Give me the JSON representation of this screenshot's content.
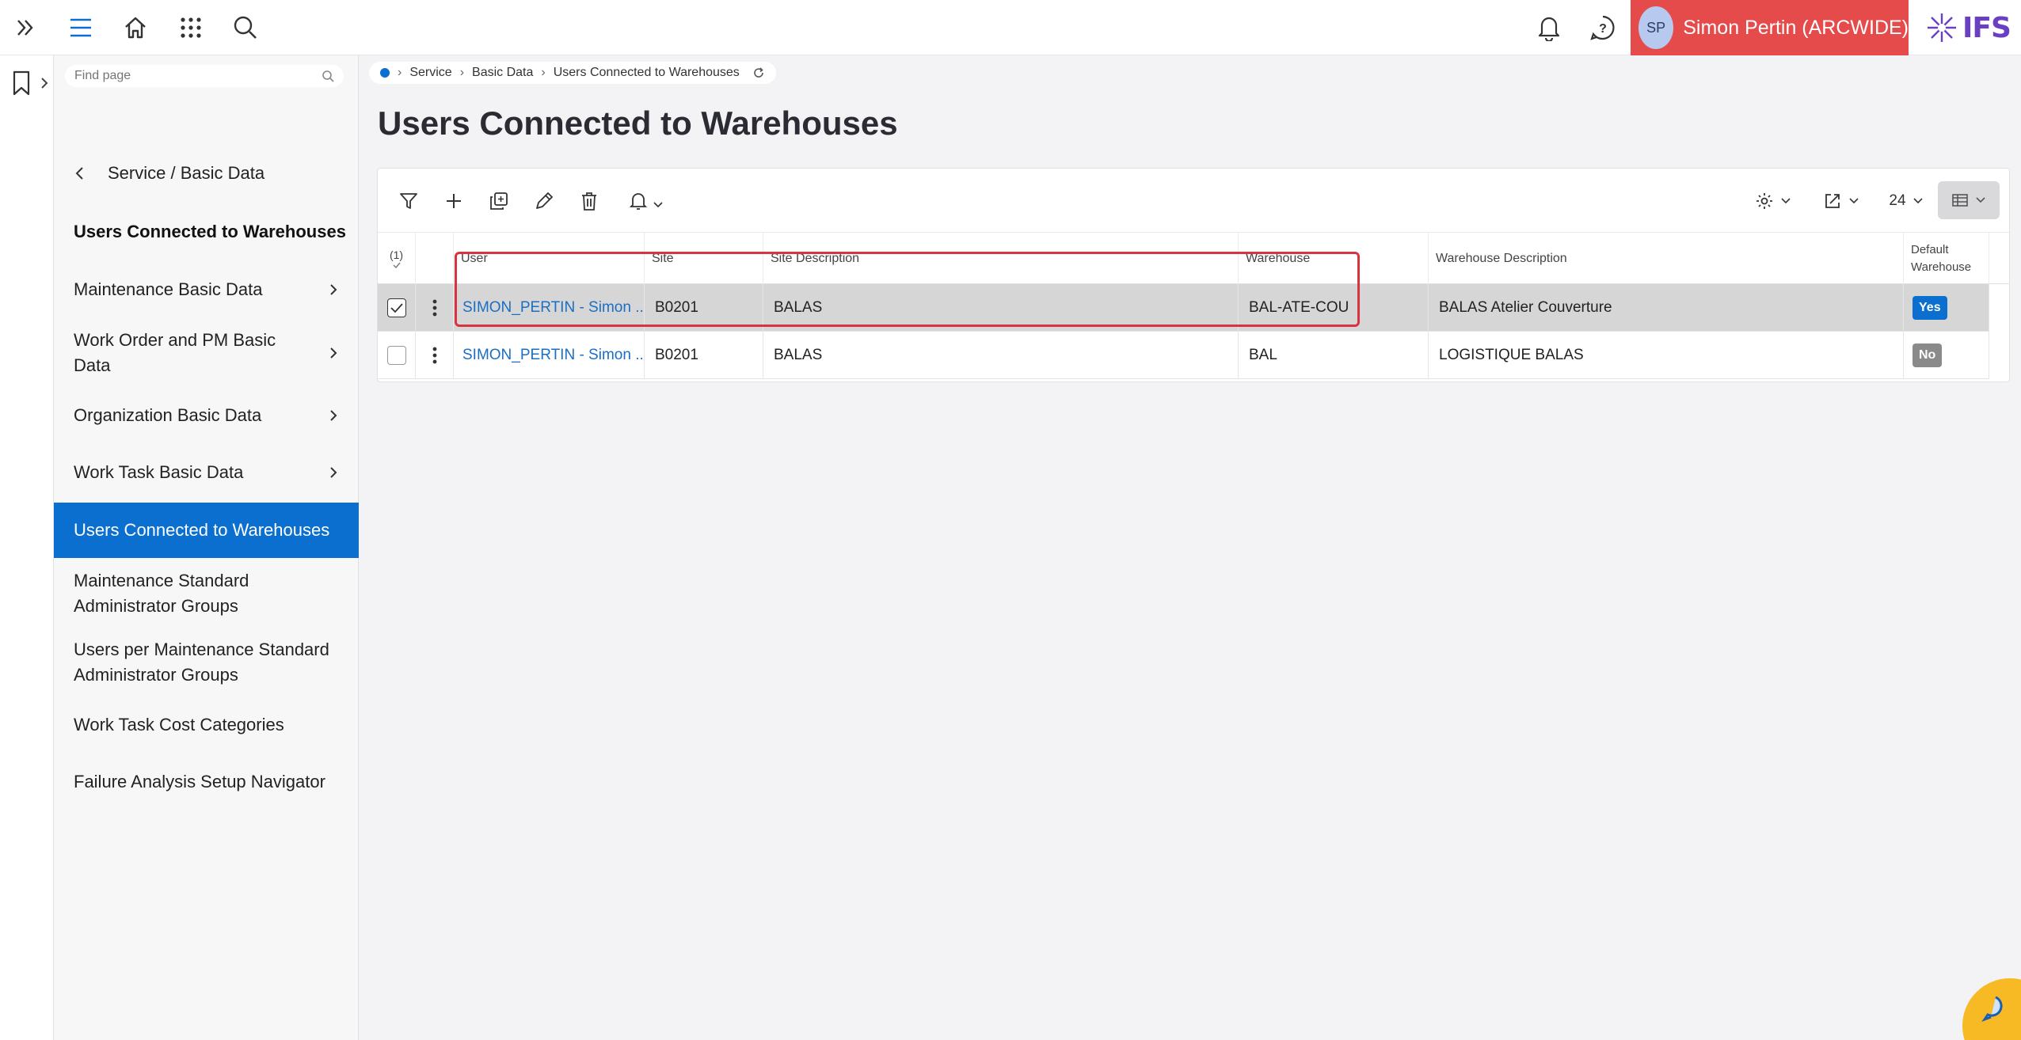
{
  "topbar": {
    "user": {
      "initials": "SP",
      "name": "Simon Pertin (ARCWIDE)"
    },
    "logo_text": "IFS",
    "colors": {
      "user_block": "#e64b4b",
      "avatar": "#b7c9ee",
      "logo": "#6b3fc2"
    },
    "icons": [
      "expand-icon",
      "menu-icon",
      "home-icon",
      "apps-grid-icon",
      "search-icon",
      "bell-icon",
      "help-icon"
    ]
  },
  "nav": {
    "find_placeholder": "Find page",
    "back_label": "Service / Basic Data",
    "title": "Users Connected to Warehouses",
    "items": [
      {
        "label": "Maintenance Basic Data",
        "has_children": true
      },
      {
        "label": "Work Order and PM Basic Data",
        "has_children": true
      },
      {
        "label": "Organization Basic Data",
        "has_children": true
      },
      {
        "label": "Work Task Basic Data",
        "has_children": true
      },
      {
        "label": "Users Connected to Warehouses",
        "active": true
      },
      {
        "label": "Maintenance Standard Administrator Groups"
      },
      {
        "label": "Users per Maintenance Standard Administrator Groups"
      },
      {
        "label": "Work Task Cost Categories"
      },
      {
        "label": "Failure Analysis Setup Navigator"
      }
    ]
  },
  "breadcrumb": [
    "Service",
    "Basic Data",
    "Users Connected to Warehouses"
  ],
  "page_title": "Users Connected to Warehouses",
  "toolbar": {
    "page_size": "24"
  },
  "table": {
    "selected_count": "(1)",
    "columns": {
      "user": "User",
      "site": "Site",
      "site_description": "Site Description",
      "warehouse": "Warehouse",
      "warehouse_description": "Warehouse Description",
      "default_warehouse_line1": "Default",
      "default_warehouse_line2": "Warehouse"
    },
    "rows": [
      {
        "selected": true,
        "user": "SIMON_PERTIN - Simon ...",
        "site": "B0201",
        "site_description": "BALAS",
        "warehouse": "BAL-ATE-COU",
        "warehouse_description": "BALAS Atelier Couverture",
        "default": "Yes"
      },
      {
        "selected": false,
        "user": "SIMON_PERTIN - Simon ...",
        "site": "B0201",
        "site_description": "BALAS",
        "warehouse": "BAL",
        "warehouse_description": "LOGISTIQUE BALAS",
        "default": "No"
      }
    ]
  }
}
